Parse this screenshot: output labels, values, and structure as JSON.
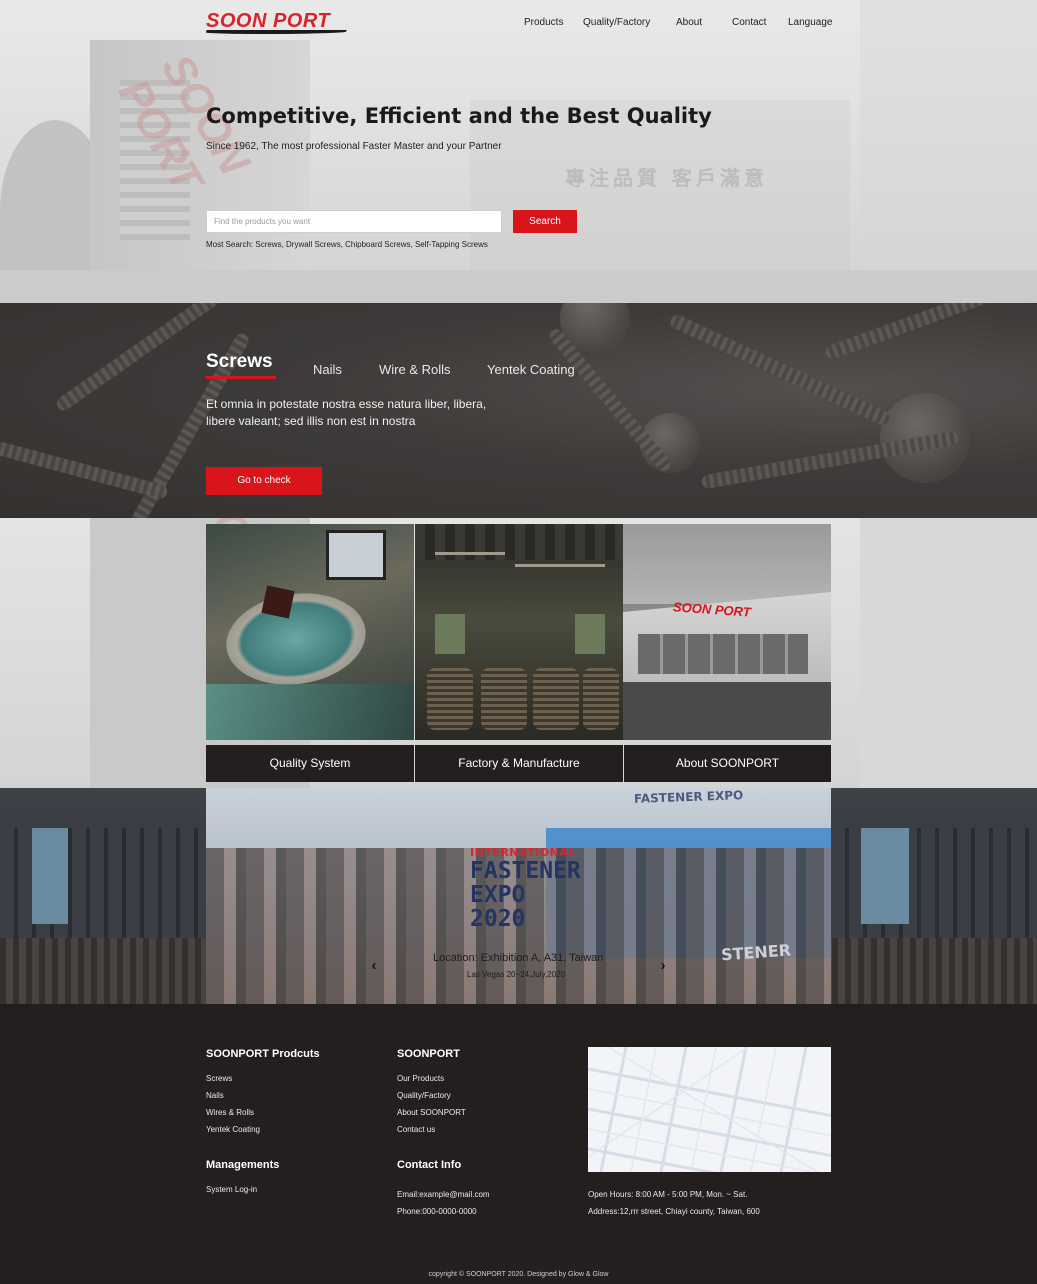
{
  "brand": {
    "logo_text": "SOON PORT",
    "accent_color": "#d9141b"
  },
  "nav": {
    "items": [
      "Products",
      "Quality/Factory",
      "About",
      "Contact",
      "Language"
    ]
  },
  "hero": {
    "title": "Competitive, Efficient and the Best Quality",
    "subtitle": "Since 1962, The most professional Faster Master and your Partner",
    "search_placeholder": "Find the products you want",
    "search_button": "Search",
    "most_search": "Most Search:  Screws, Drywall Screws, Chipboard Screws, Self-Tapping Screws",
    "background_sign": "專注品質  客戶滿意"
  },
  "products": {
    "tabs": [
      "Screws",
      "Nails",
      "Wire & Rolls",
      "Yentek Coating"
    ],
    "active_tab": "Screws",
    "description": "Et omnia in potestate nostra esse natura liber, libera, libere valeant; sed illis non est in nostra",
    "cta": "Go to check"
  },
  "features": {
    "cards": [
      {
        "label": "Quality System",
        "image": "quality-lab-photo"
      },
      {
        "label": "Factory & Manufacture",
        "image": "factory-floor-photo"
      },
      {
        "label": "About SOONPORT",
        "image": "company-building-photo"
      }
    ],
    "building_sign": "SOON PORT"
  },
  "expo": {
    "logo_line1": "INTERNATIONAL",
    "logo_line2": "FASTENER",
    "logo_line3": "EXPO 2020",
    "banner_top": "FASTENER EXPO",
    "banner_right": "STENER",
    "location": "Location: Exhibition A, A31, Taiwan",
    "date": "Las Vegas 20~24,July,2020",
    "prev_icon": "‹",
    "next_icon": "›"
  },
  "footer": {
    "products": {
      "heading": "SOONPORT Prodcuts",
      "links": [
        "Screws",
        "Nails",
        "Wires & Rolls",
        "Yentek Coating"
      ]
    },
    "company": {
      "heading": "SOONPORT",
      "links": [
        "Our Products",
        "Quality/Factory",
        "About SOONPORT",
        "Contact us"
      ]
    },
    "managements": {
      "heading": "Managements",
      "links": [
        "System Log-in"
      ]
    },
    "contact": {
      "heading": "Contact Info",
      "email": "Email:example@mail.com",
      "phone": "Phone:000-0000-0000",
      "hours": "Open Hours: 8:00 AM - 5:00 PM, Mon. ~ Sat.",
      "address": "Address:12,rrr street, Chiayi county, Taiwan, 600"
    },
    "copyright": "copyright © SOONPORT 2020. Designed by Glow & Glow"
  }
}
